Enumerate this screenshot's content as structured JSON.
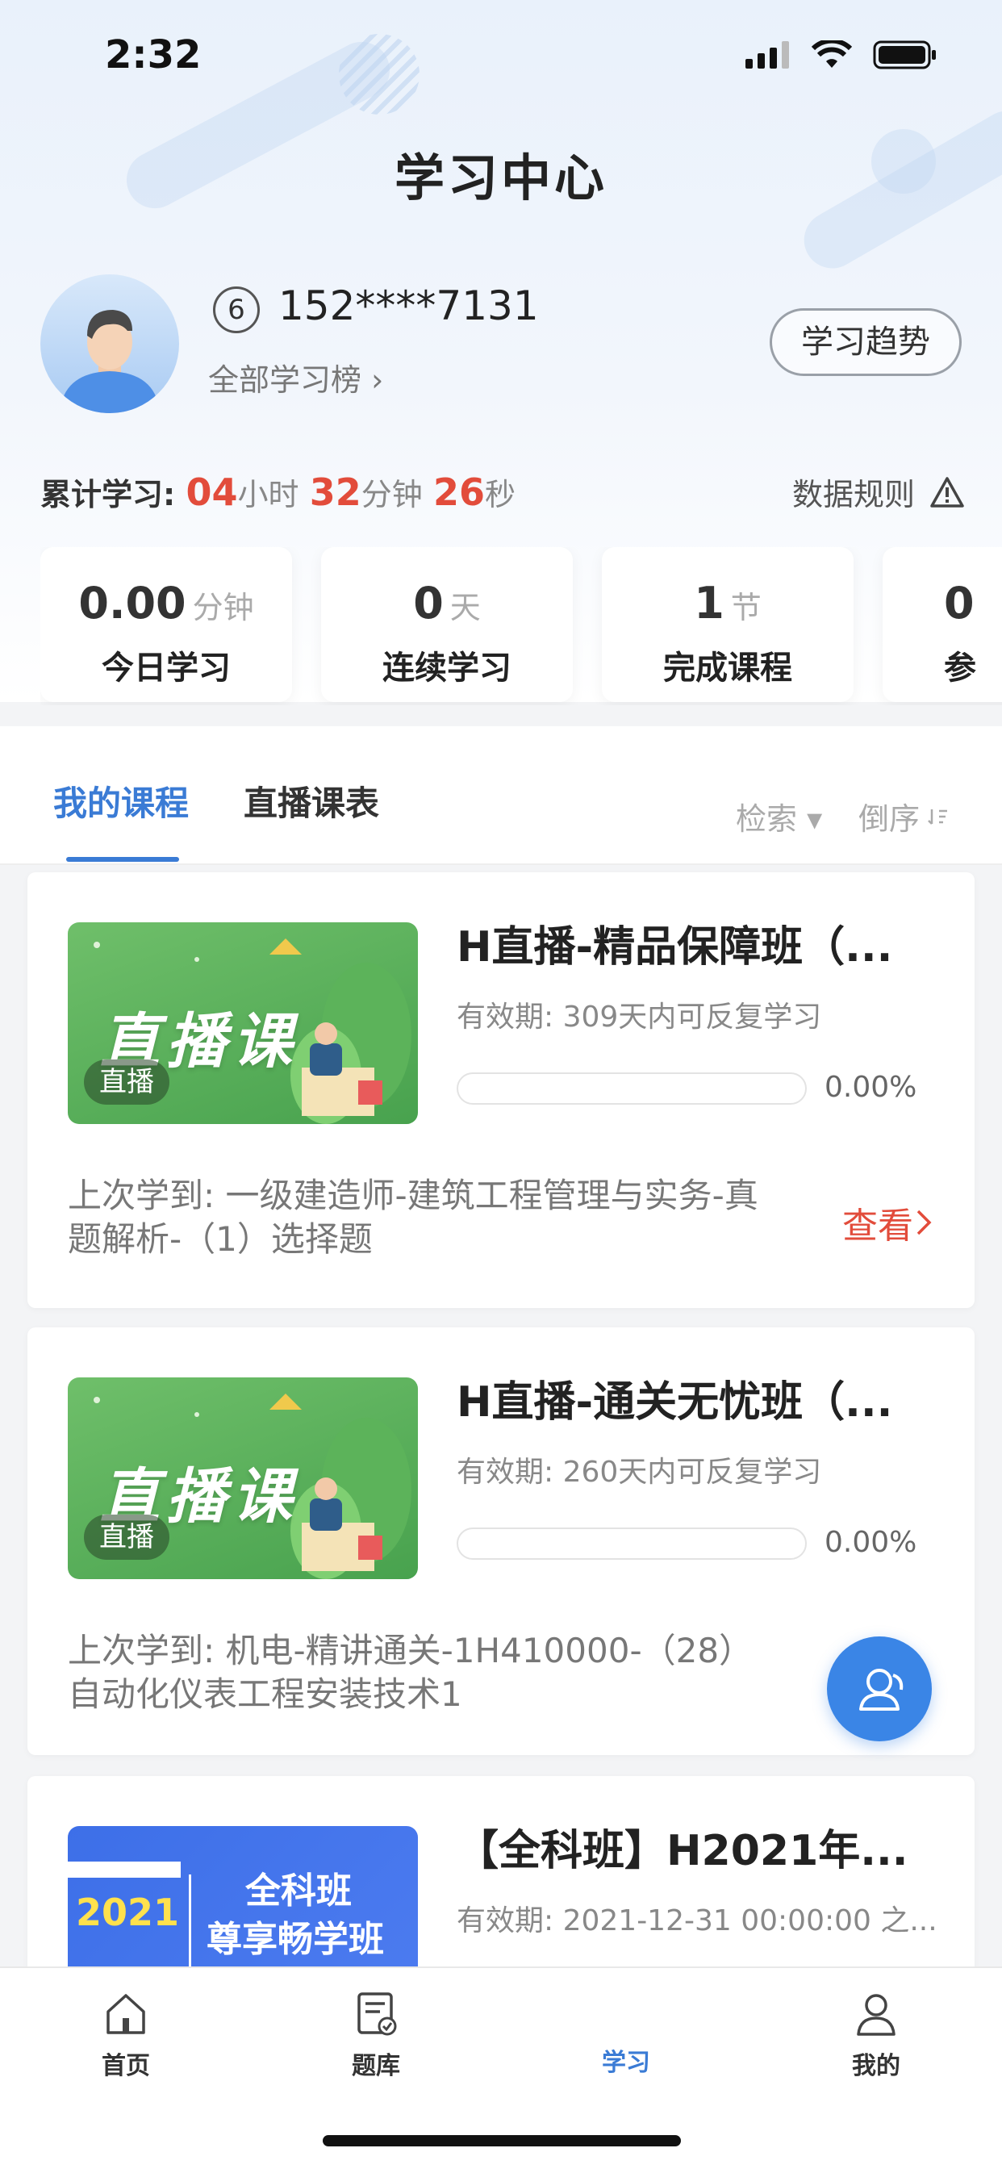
{
  "status_bar": {
    "time": "2:32"
  },
  "header": {
    "title": "学习中心"
  },
  "profile": {
    "level": "6",
    "phone": "152****7131",
    "rank_link": "全部学习榜 ›",
    "trend_button": "学习趋势"
  },
  "cumulative": {
    "label": "累计学习:",
    "hours": "04",
    "hours_unit": "小时",
    "minutes": "32",
    "minutes_unit": "分钟",
    "seconds": "26",
    "seconds_unit": "秒",
    "rules_label": "数据规则"
  },
  "stats": [
    {
      "value": "0.00",
      "unit": "分钟",
      "label": "今日学习"
    },
    {
      "value": "0",
      "unit": "天",
      "label": "连续学习"
    },
    {
      "value": "1",
      "unit": "节",
      "label": "完成课程"
    },
    {
      "value": "0",
      "unit": "",
      "label": "参"
    }
  ],
  "tabs": {
    "my_courses": "我的课程",
    "live_schedule": "直播课表",
    "search": "检索 ▾",
    "sort": "倒序"
  },
  "courses": [
    {
      "thumb_text": "直播课",
      "thumb_tag": "直播",
      "title": "H直播-精品保障班（...",
      "validity": "有效期: 309天内可反复学习",
      "progress": 0,
      "progress_text": "0.00%",
      "last": "上次学到: 一级建造师-建筑工程管理与实务-真题解析-（1）选择题",
      "view": "查看"
    },
    {
      "thumb_text": "直播课",
      "thumb_tag": "直播",
      "title": "H直播-通关无忧班（...",
      "validity": "有效期: 260天内可反复学习",
      "progress": 0,
      "progress_text": "0.00%",
      "last": "上次学到: 机电-精讲通关-1H410000-（28）自动化仪表工程安装技术1",
      "view": ""
    },
    {
      "thumb_year": "2021",
      "thumb_line1": "全科班",
      "thumb_line2": "尊享畅学班",
      "title": "【全科班】H2021年...",
      "validity": "有效期: 2021-12-31 00:00:00 之..."
    }
  ],
  "bottom_nav": [
    {
      "label": "首页",
      "icon": "home-icon"
    },
    {
      "label": "题库",
      "icon": "question-bank-icon"
    },
    {
      "label": "学习",
      "icon": "study-icon"
    },
    {
      "label": "我的",
      "icon": "profile-icon"
    }
  ],
  "colors": {
    "accent": "#3a7bd5",
    "highlight": "#e24c3b"
  }
}
